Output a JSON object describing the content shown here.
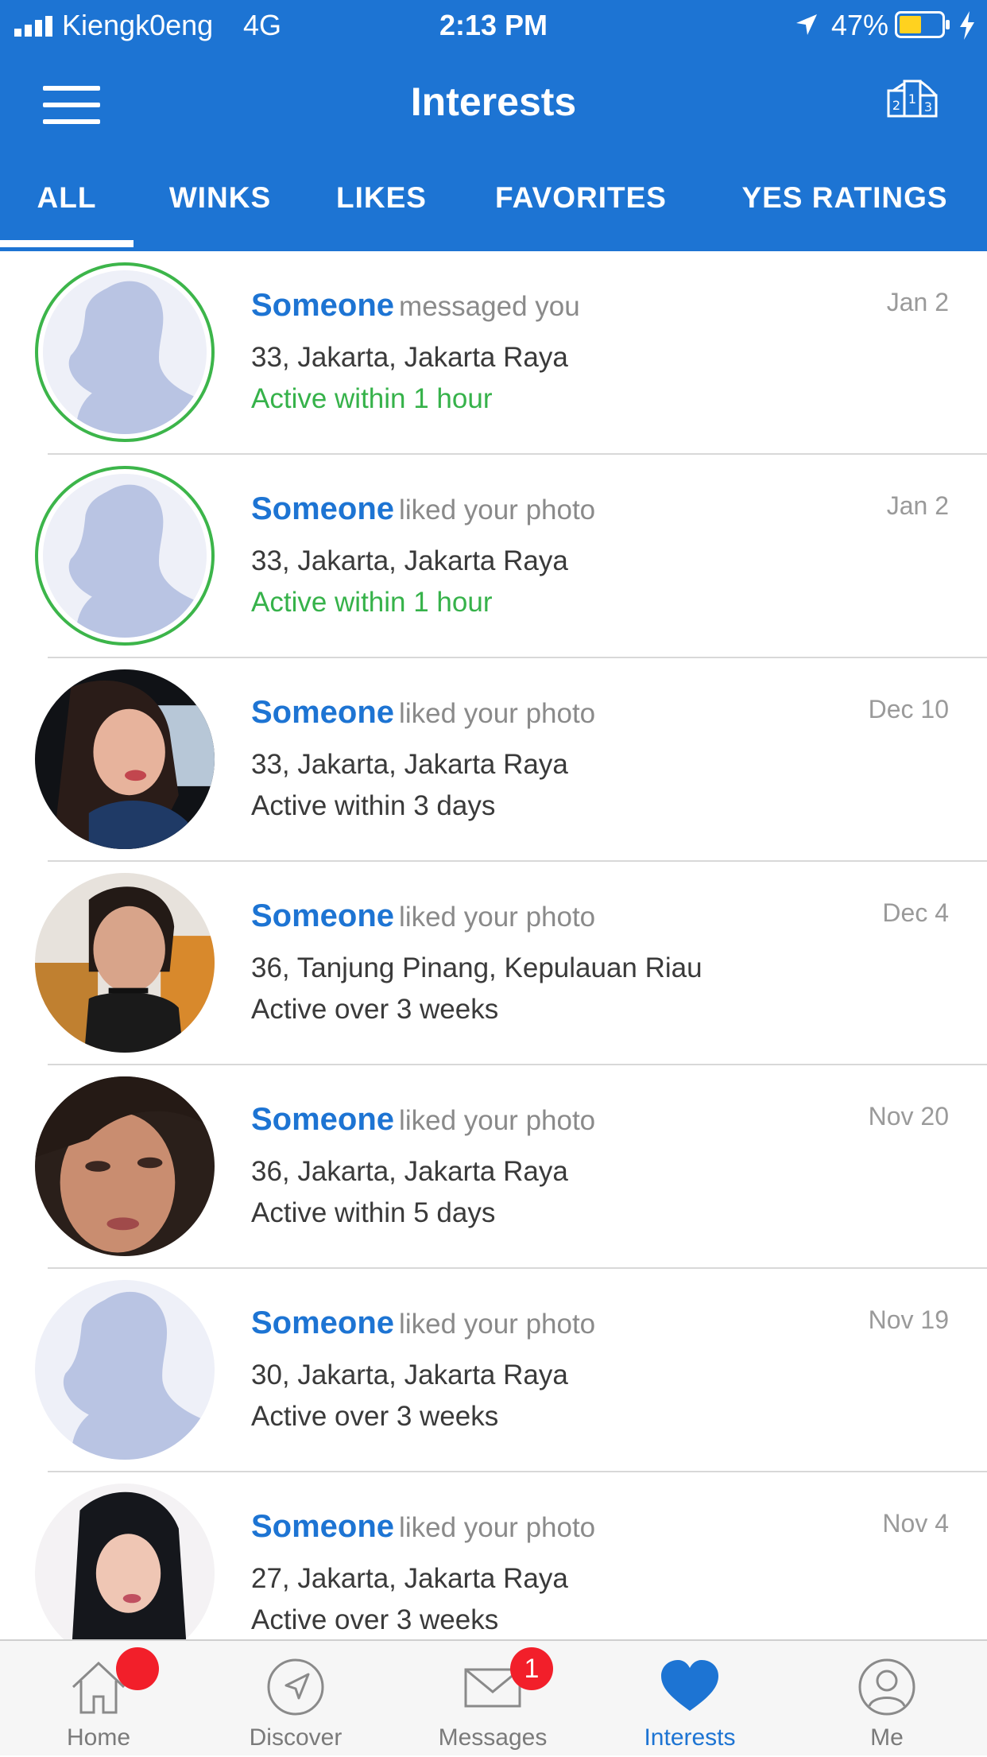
{
  "status_bar": {
    "carrier": "Kiengk0eng",
    "network": "4G",
    "time": "2:13 PM",
    "battery": "47%"
  },
  "header": {
    "title": "Interests"
  },
  "tabs": [
    {
      "label": "ALL",
      "active": true
    },
    {
      "label": "WINKS",
      "active": false
    },
    {
      "label": "LIKES",
      "active": false
    },
    {
      "label": "FAVORITES",
      "active": false
    },
    {
      "label": "YES RATINGS",
      "active": false
    }
  ],
  "items": [
    {
      "name": "Someone",
      "action": "messaged you",
      "details": "33, Jakarta, Jakarta Raya",
      "activity": "Active within 1 hour",
      "date": "Jan 2",
      "avatar": "silhouette",
      "online": true
    },
    {
      "name": "Someone",
      "action": "liked your photo",
      "details": "33, Jakarta, Jakarta Raya",
      "activity": "Active within 1 hour",
      "date": "Jan 2",
      "avatar": "silhouette",
      "online": true
    },
    {
      "name": "Someone",
      "action": "liked your photo",
      "details": "33, Jakarta, Jakarta Raya",
      "activity": "Active within 3 days",
      "date": "Dec 10",
      "avatar": "photo",
      "online": false
    },
    {
      "name": "Someone",
      "action": "liked your photo",
      "details": "36, Tanjung Pinang, Kepulauan Riau",
      "activity": "Active over 3 weeks",
      "date": "Dec 4",
      "avatar": "photo",
      "online": false
    },
    {
      "name": "Someone",
      "action": "liked your photo",
      "details": "36, Jakarta, Jakarta Raya",
      "activity": "Active within 5 days",
      "date": "Nov 20",
      "avatar": "photo",
      "online": false
    },
    {
      "name": "Someone",
      "action": "liked your photo",
      "details": "30, Jakarta, Jakarta Raya",
      "activity": "Active over 3 weeks",
      "date": "Nov 19",
      "avatar": "silhouette",
      "online": false
    },
    {
      "name": "Someone",
      "action": "liked your photo",
      "details": "27, Jakarta, Jakarta Raya",
      "activity": "Active over 3 weeks",
      "date": "Nov 4",
      "avatar": "photo",
      "online": false
    }
  ],
  "tab_bar": [
    {
      "label": "Home",
      "icon": "home-icon",
      "badge": "",
      "active": false
    },
    {
      "label": "Discover",
      "icon": "compass-icon",
      "badge": "",
      "active": false
    },
    {
      "label": "Messages",
      "icon": "mail-icon",
      "badge": "1",
      "active": false
    },
    {
      "label": "Interests",
      "icon": "heart-icon",
      "badge": "",
      "active": true
    },
    {
      "label": "Me",
      "icon": "user-icon",
      "badge": "",
      "active": false
    }
  ],
  "colors": {
    "brand_blue": "#1d74d3",
    "online_green": "#36b24a",
    "badge_red": "#f21f2a"
  }
}
